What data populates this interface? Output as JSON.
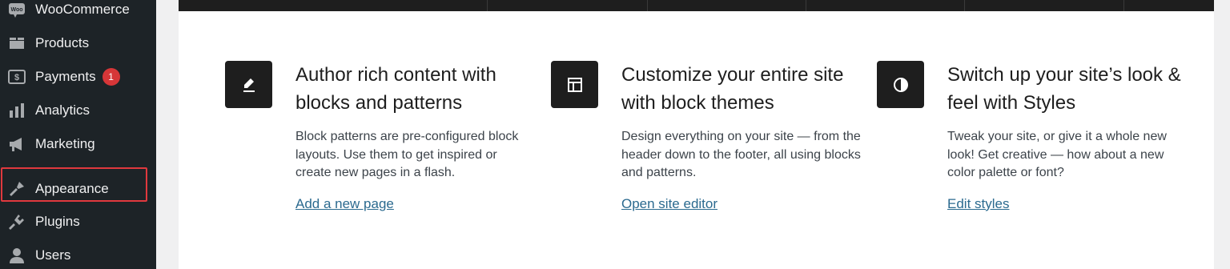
{
  "sidebar": {
    "items": [
      {
        "label": "WooCommerce",
        "icon": "woocommerce-icon"
      },
      {
        "label": "Products",
        "icon": "products-icon"
      },
      {
        "label": "Payments",
        "icon": "payments-icon",
        "badge": "1"
      },
      {
        "label": "Analytics",
        "icon": "analytics-icon"
      },
      {
        "label": "Marketing",
        "icon": "marketing-icon"
      },
      {
        "label": "Appearance",
        "icon": "appearance-icon",
        "highlighted": true
      },
      {
        "label": "Plugins",
        "icon": "plugins-icon"
      },
      {
        "label": "Users",
        "icon": "users-icon"
      }
    ]
  },
  "features": [
    {
      "icon": "pencil-icon",
      "title": "Author rich content with blocks and patterns",
      "description": "Block patterns are pre-configured block layouts. Use them to get inspired or create new pages in a flash.",
      "link": "Add a new page"
    },
    {
      "icon": "layout-icon",
      "title": "Customize your entire site with block themes",
      "description": "Design everything on your site — from the header down to the footer, all using blocks and patterns.",
      "link": "Open site editor"
    },
    {
      "icon": "contrast-icon",
      "title": "Switch up your site’s look & feel with Styles",
      "description": "Tweak your site, or give it a whole new look! Get creative — how about a new color palette or font?",
      "link": "Edit styles"
    }
  ],
  "colors": {
    "sidebar_bg": "#1d2327",
    "highlight_border": "#e0393e",
    "badge": "#d63638",
    "link": "#2b6a8f"
  }
}
